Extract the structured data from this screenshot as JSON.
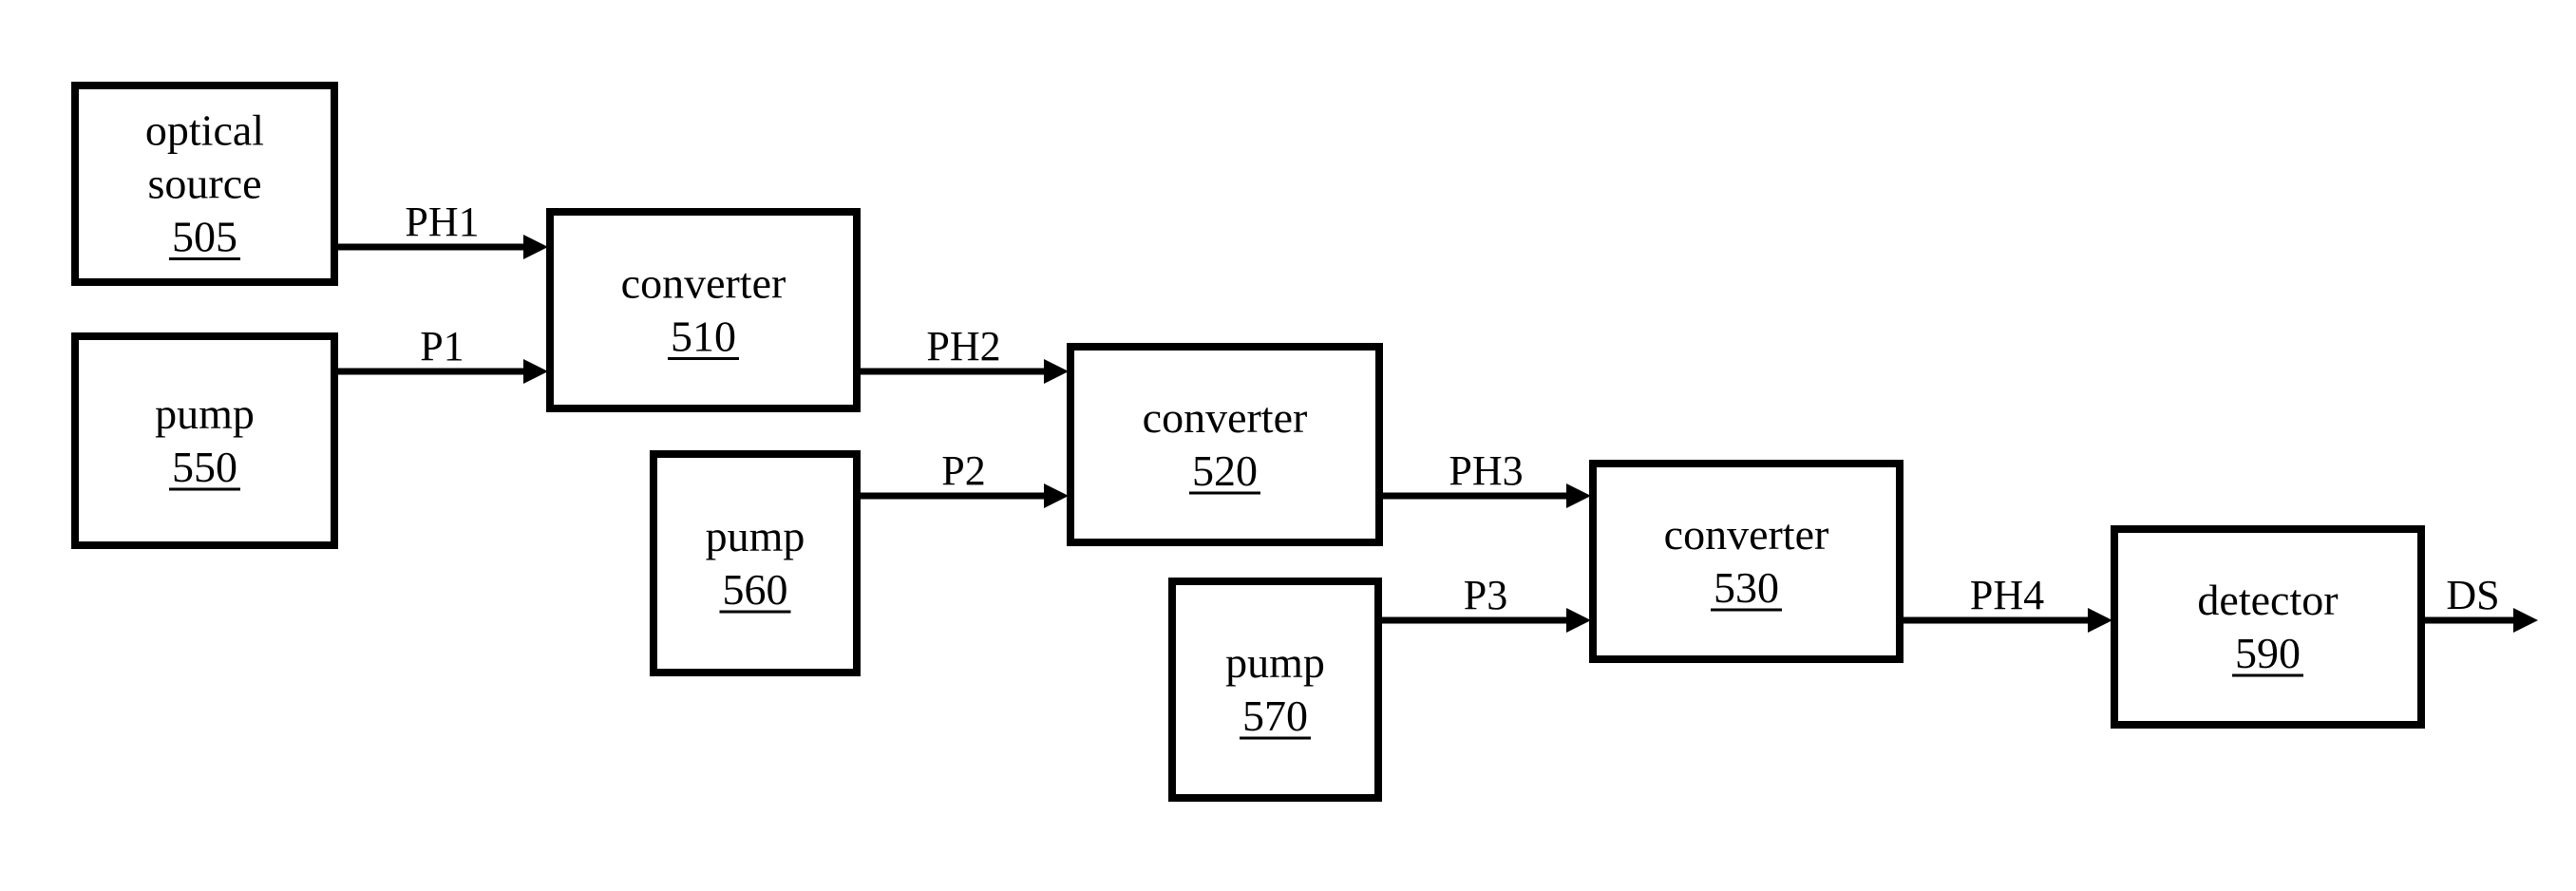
{
  "diagram": {
    "nodes": [
      {
        "id": "505",
        "lines": [
          "optical",
          "source"
        ],
        "ref": "505"
      },
      {
        "id": "550",
        "lines": [
          "pump"
        ],
        "ref": "550"
      },
      {
        "id": "510",
        "lines": [
          "converter"
        ],
        "ref": "510"
      },
      {
        "id": "560",
        "lines": [
          "pump"
        ],
        "ref": "560"
      },
      {
        "id": "520",
        "lines": [
          "converter"
        ],
        "ref": "520"
      },
      {
        "id": "570",
        "lines": [
          "pump"
        ],
        "ref": "570"
      },
      {
        "id": "530",
        "lines": [
          "converter"
        ],
        "ref": "530"
      },
      {
        "id": "590",
        "lines": [
          "detector"
        ],
        "ref": "590"
      }
    ],
    "edges": [
      {
        "from": "505",
        "to": "510",
        "label": "PH1"
      },
      {
        "from": "550",
        "to": "510",
        "label": "P1"
      },
      {
        "from": "510",
        "to": "520",
        "label": "PH2"
      },
      {
        "from": "560",
        "to": "520",
        "label": "P2"
      },
      {
        "from": "520",
        "to": "530",
        "label": "PH3"
      },
      {
        "from": "570",
        "to": "530",
        "label": "P3"
      },
      {
        "from": "530",
        "to": "590",
        "label": "PH4"
      },
      {
        "from": "590",
        "to": null,
        "label": "DS"
      }
    ],
    "colors": {
      "stroke": "#000000",
      "background": "#ffffff"
    }
  }
}
